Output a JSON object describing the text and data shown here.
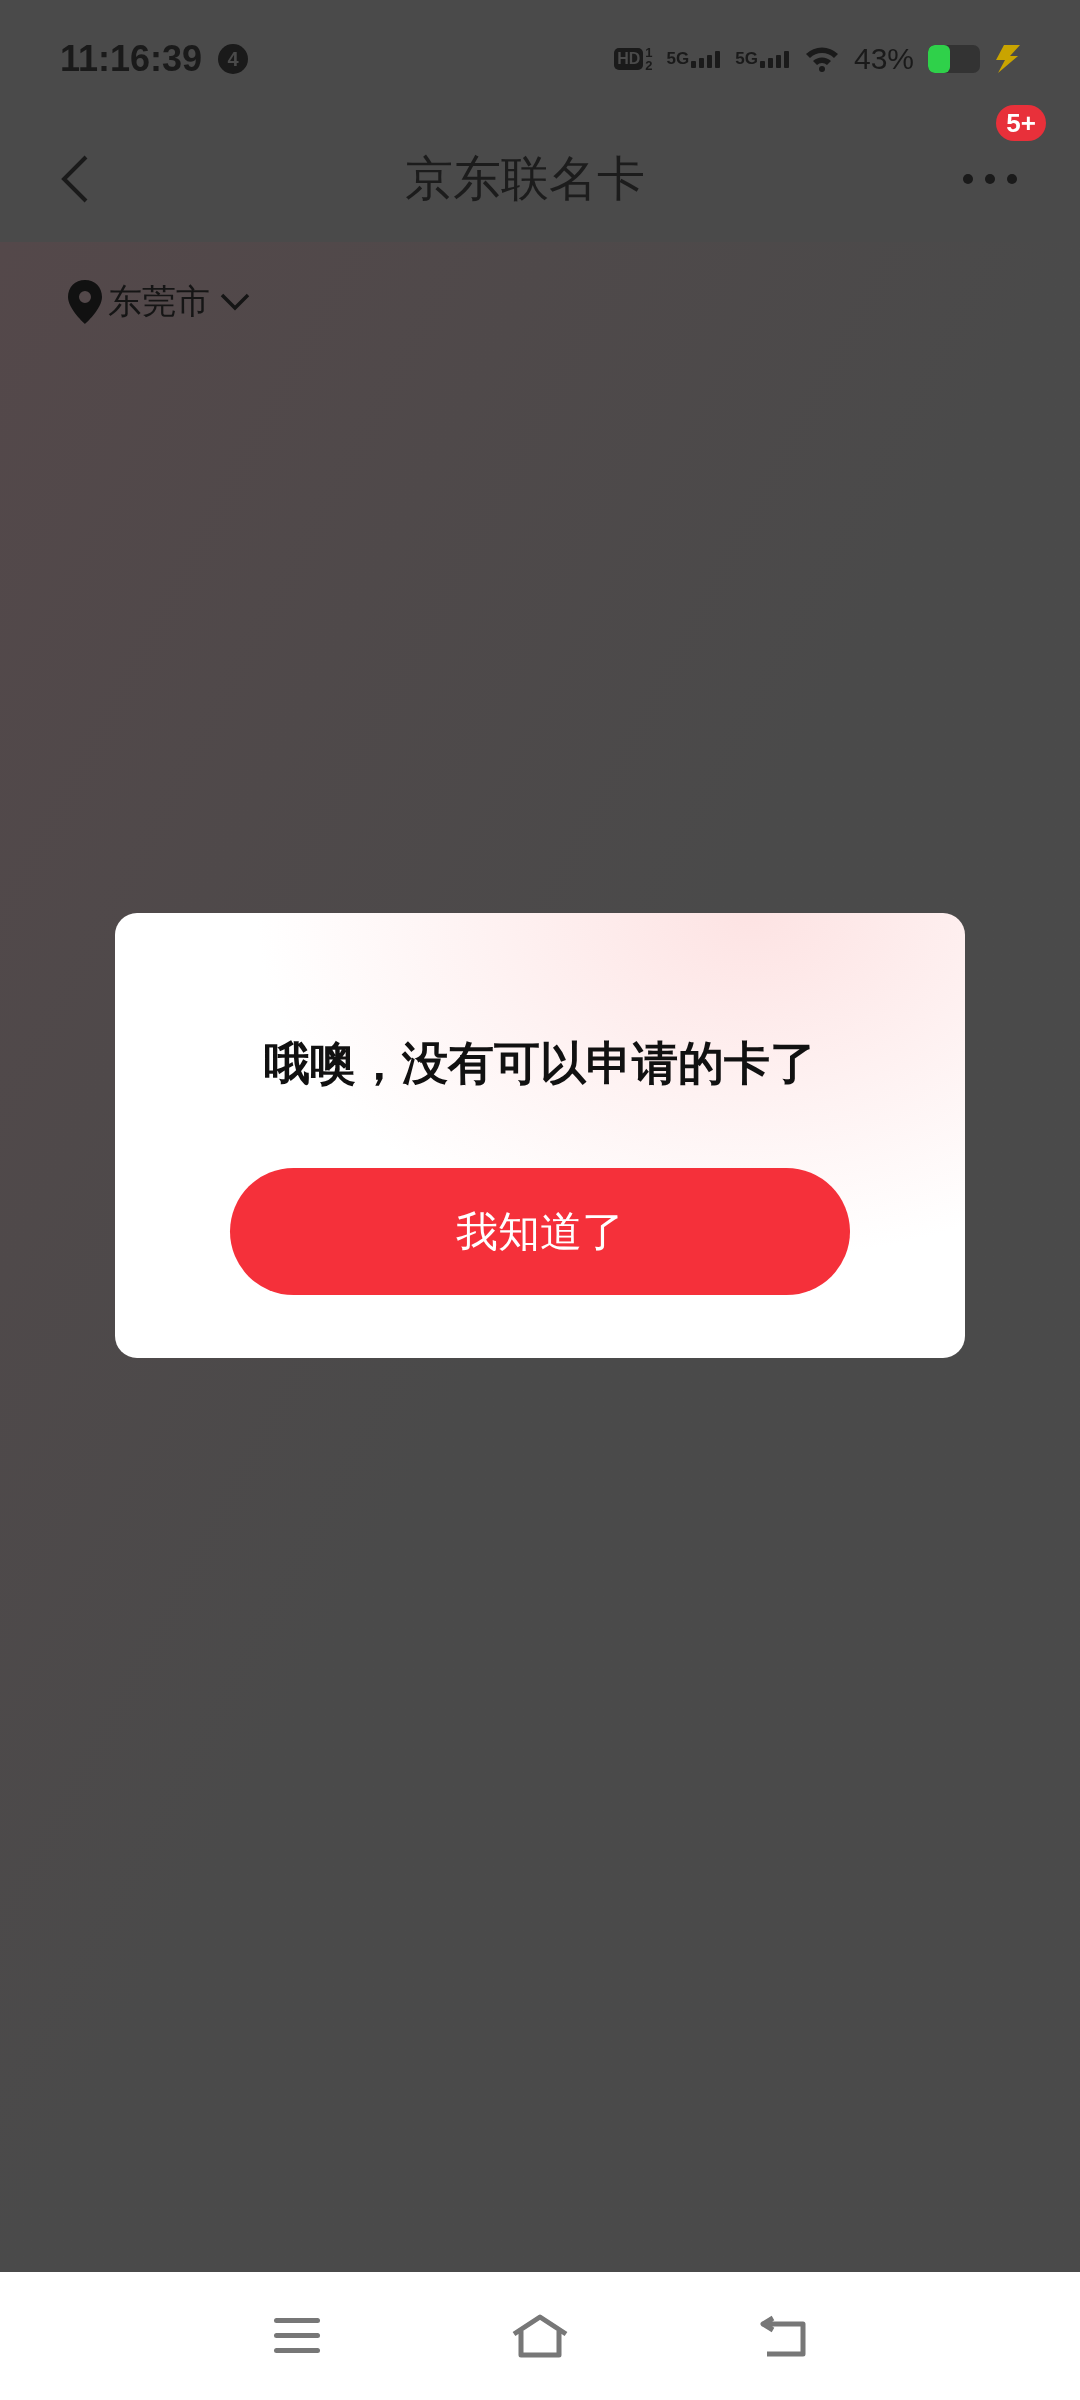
{
  "status_bar": {
    "time": "11:16:39",
    "notification_count": "4",
    "hd": "HD",
    "hd_sims": [
      "1",
      "2"
    ],
    "networks": [
      "5G",
      "5G"
    ],
    "battery": "43%",
    "charging": true
  },
  "header": {
    "title": "京东联名卡",
    "more_badge": "5+"
  },
  "location": {
    "city": "东莞市"
  },
  "dialog": {
    "message": "哦噢，没有可以申请的卡了",
    "button": "我知道了"
  }
}
